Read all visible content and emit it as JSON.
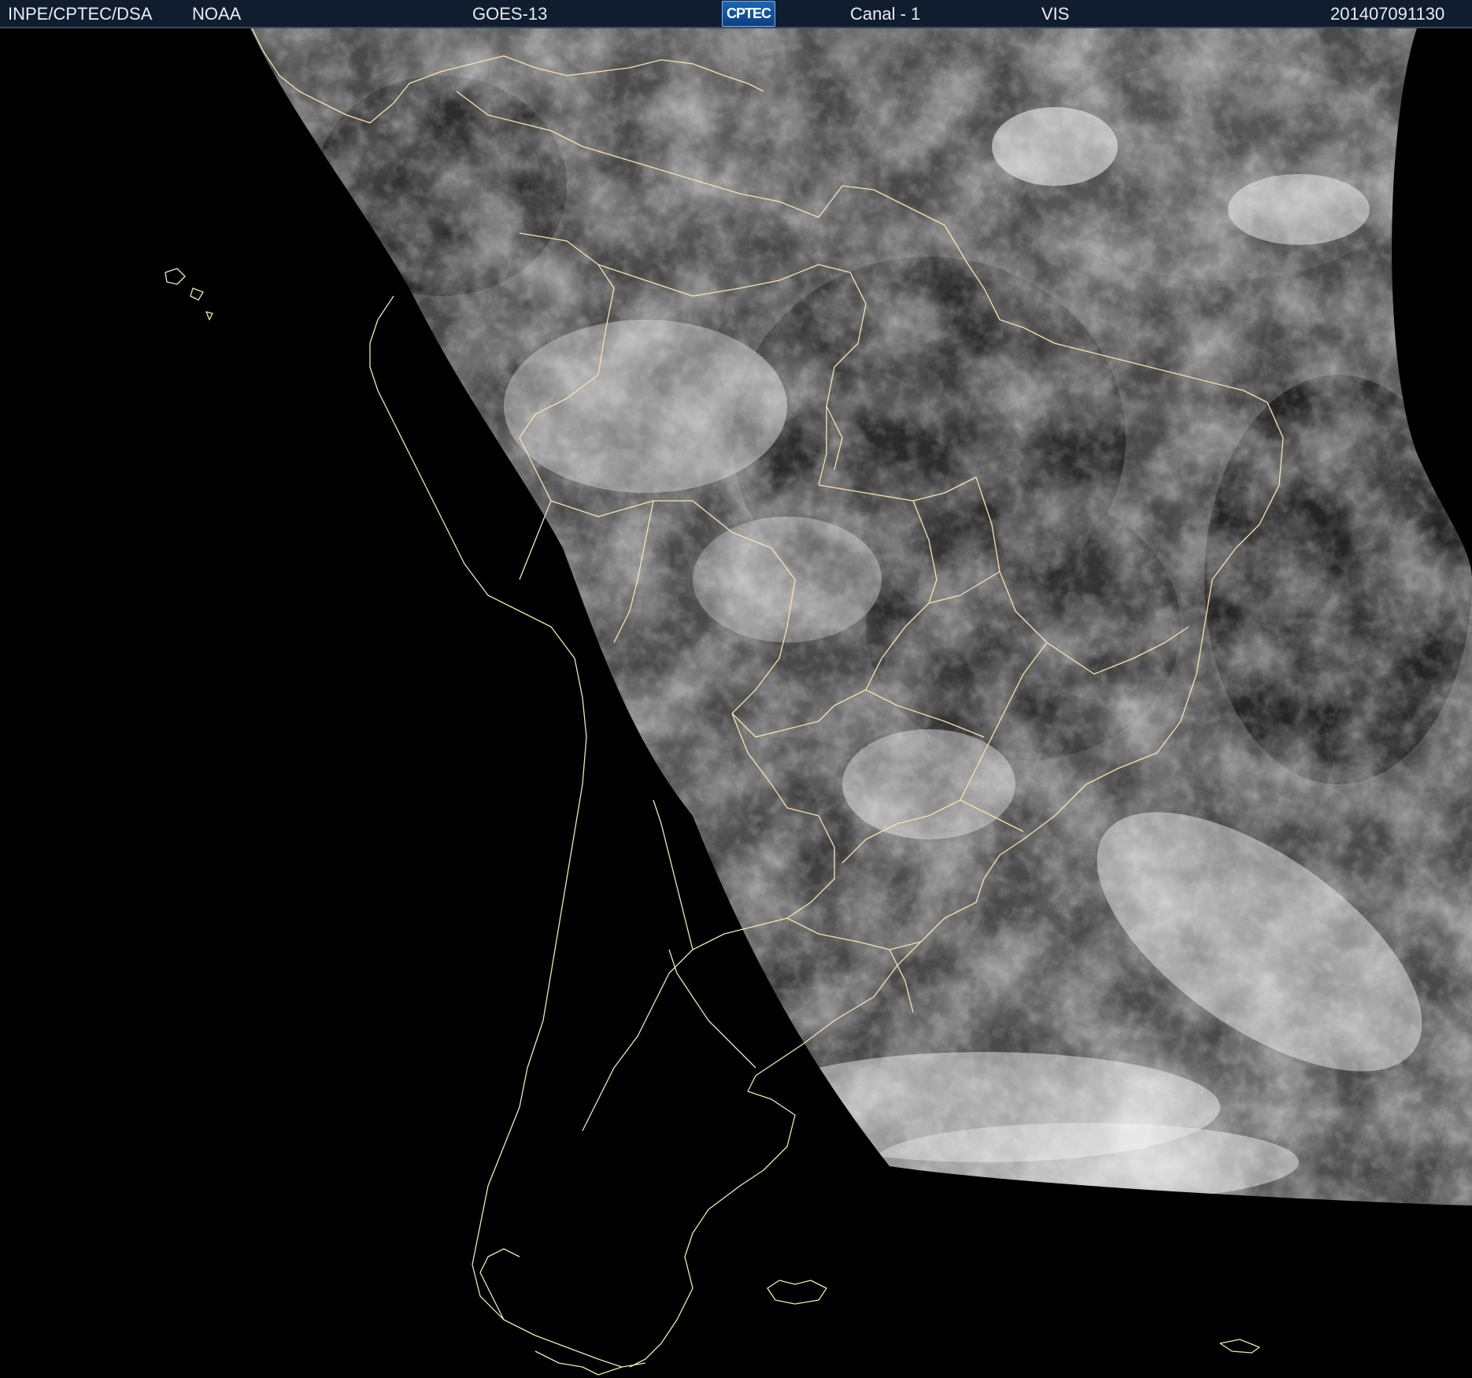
{
  "header": {
    "org": "INPE/CPTEC/DSA",
    "agency": "NOAA",
    "satellite": "GOES-13",
    "logo_text": "CPTEC",
    "channel": "Canal - 1",
    "band": "VIS",
    "timestamp": "201407091130"
  },
  "colors": {
    "header_background": "#0f1d2f",
    "header_text": "#e8edf5",
    "background": "#000000",
    "coastline": "#f0eaa8",
    "logo_blue": "#1a66b8"
  }
}
